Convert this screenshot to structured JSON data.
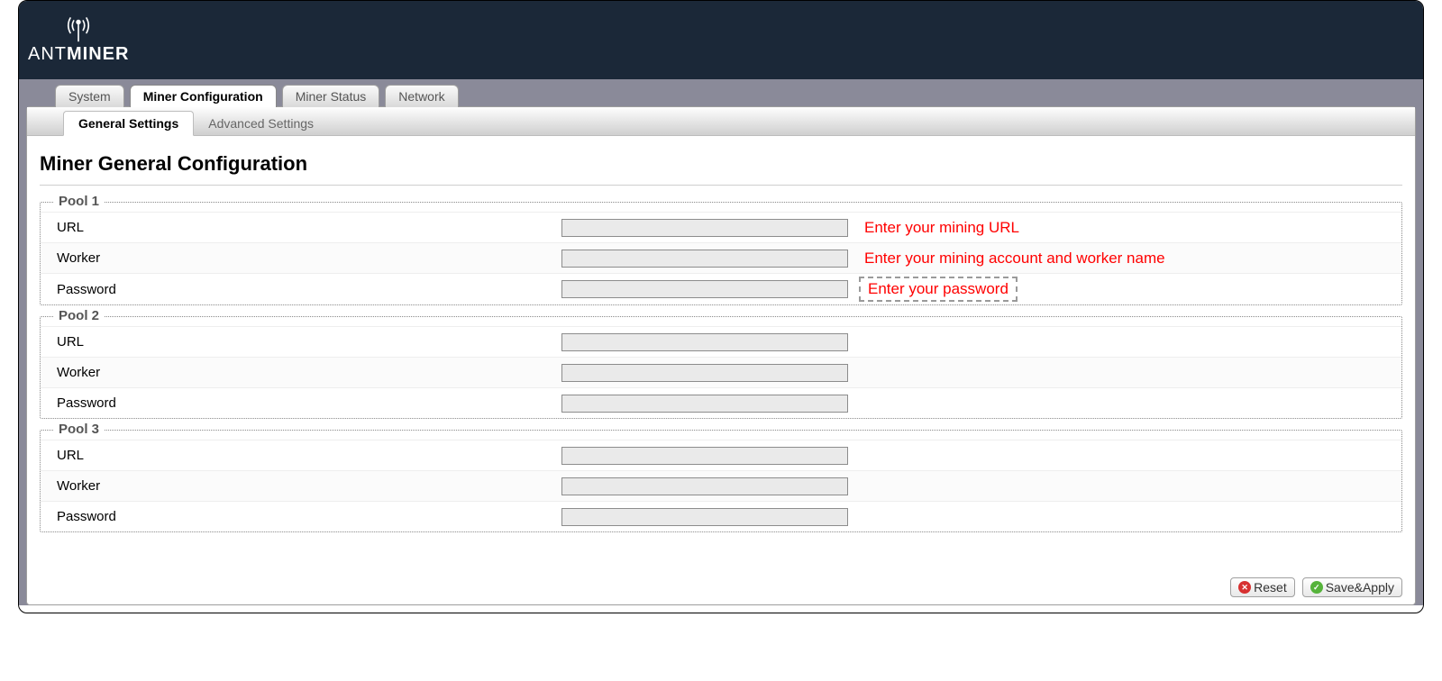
{
  "brand": {
    "light": "ANT",
    "bold": "MINER"
  },
  "tabs_top": {
    "system": "System",
    "miner_config": "Miner Configuration",
    "miner_status": "Miner Status",
    "network": "Network",
    "active": "miner_config"
  },
  "tabs_sub": {
    "general": "General Settings",
    "advanced": "Advanced Settings",
    "active": "general"
  },
  "heading": "Miner General Configuration",
  "labels": {
    "url": "URL",
    "worker": "Worker",
    "password": "Password"
  },
  "pools": [
    {
      "legend": "Pool 1",
      "url": "",
      "worker": "",
      "password": "",
      "hints": {
        "url": "Enter your mining URL",
        "worker": "Enter your mining account and worker name",
        "password": "Enter your password"
      }
    },
    {
      "legend": "Pool 2",
      "url": "",
      "worker": "",
      "password": ""
    },
    {
      "legend": "Pool 3",
      "url": "",
      "worker": "",
      "password": ""
    }
  ],
  "buttons": {
    "reset": "Reset",
    "save_apply": "Save&Apply"
  }
}
